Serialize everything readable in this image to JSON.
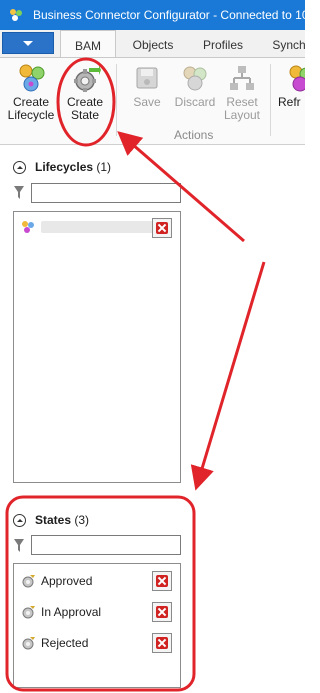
{
  "window": {
    "title": "Business Connector Configurator - Connected to 10.",
    "title_color": "#1a79d6"
  },
  "tabs": [
    {
      "label": "BAM",
      "active": true
    },
    {
      "label": "Objects",
      "active": false
    },
    {
      "label": "Profiles",
      "active": false
    },
    {
      "label": "Synch",
      "active": false
    }
  ],
  "ribbon": {
    "create_lifecycle": "Create Lifecycle",
    "create_state": "Create State",
    "save": "Save",
    "discard": "Discard",
    "reset_layout": "Reset Layout",
    "refresh": "Refr",
    "actions_group": "Actions"
  },
  "lifecycles": {
    "title": "Lifecycles",
    "count": "(1)",
    "filter_value": "",
    "items": [
      {
        "label": "",
        "redacted": true,
        "icon": "lifecycle-icon"
      }
    ]
  },
  "states": {
    "title": "States",
    "count": "(3)",
    "filter_value": "",
    "items": [
      {
        "label": "Approved",
        "icon": "state-gear-icon"
      },
      {
        "label": "In Approval",
        "icon": "state-gear-icon"
      },
      {
        "label": "Rejected",
        "icon": "state-gear-icon"
      }
    ]
  },
  "annotation": {
    "color": "#e0242a"
  }
}
